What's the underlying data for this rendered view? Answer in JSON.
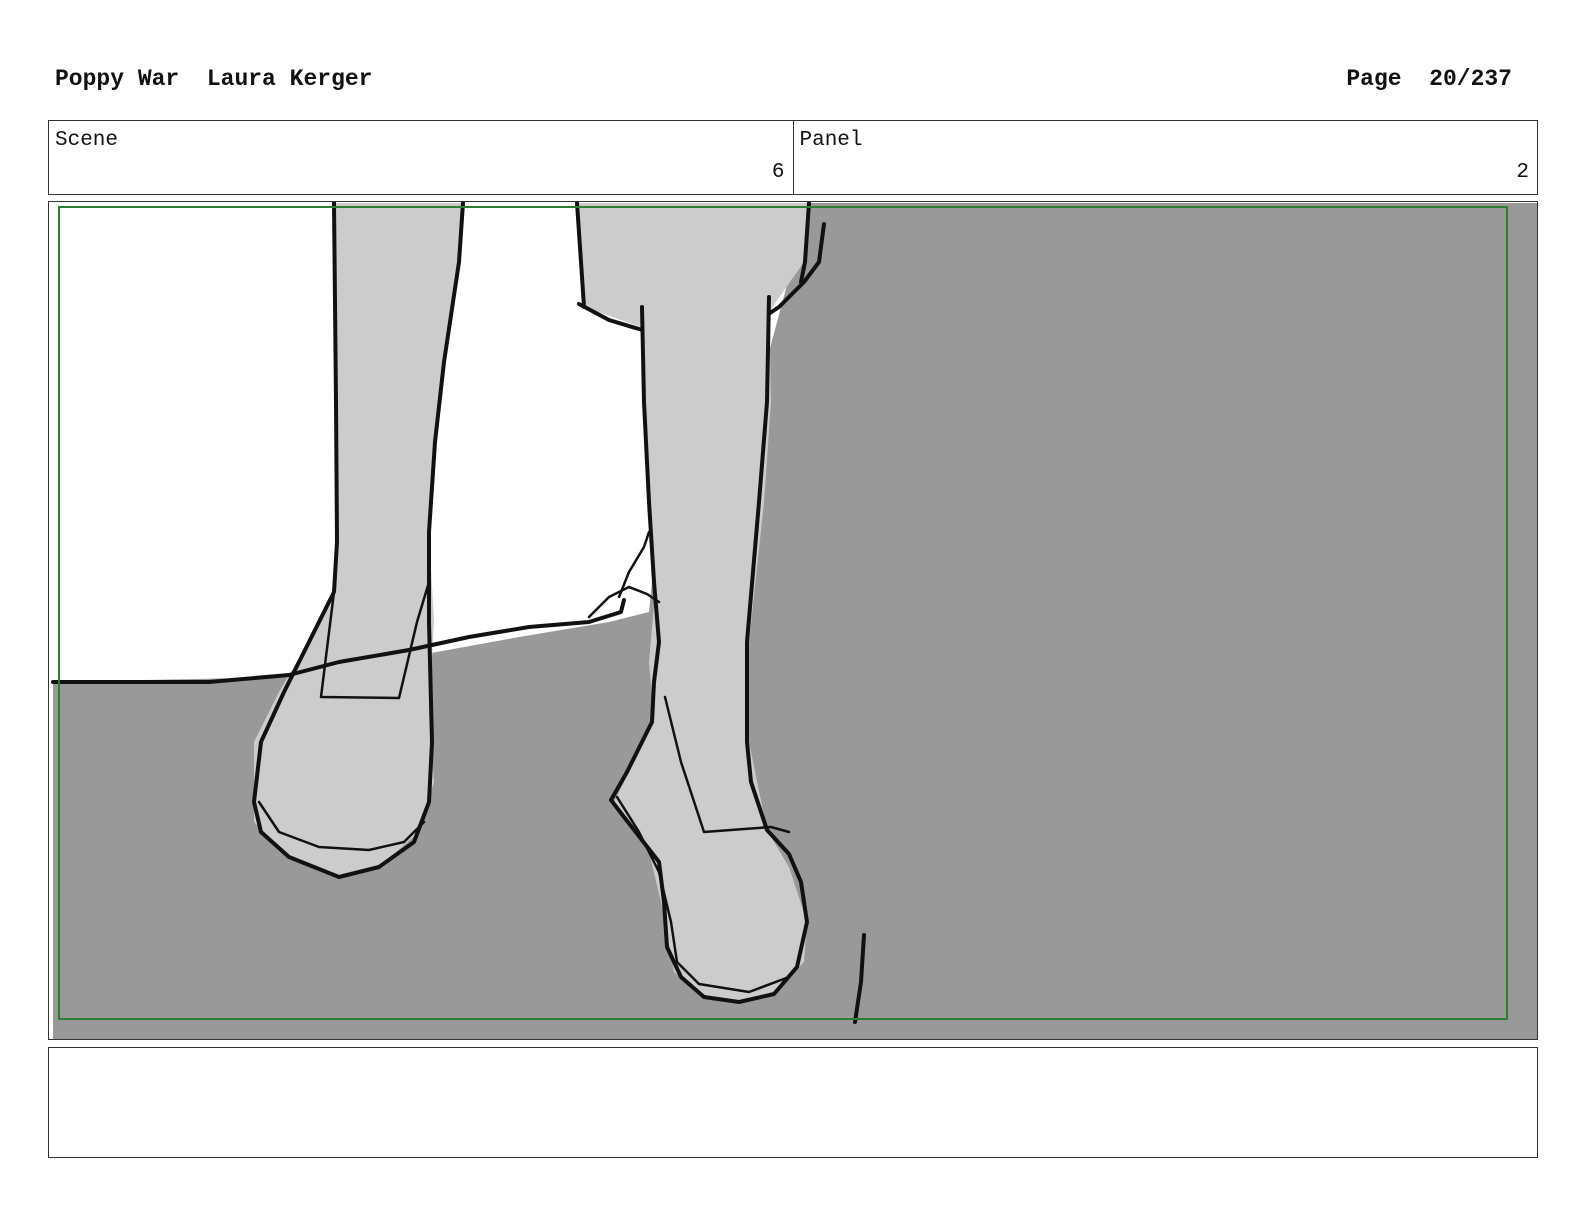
{
  "header": {
    "project": "Poppy War",
    "author": "Laura Kerger",
    "page_label": "Page",
    "page_number": "20/237"
  },
  "scene": {
    "label": "Scene",
    "value": "6"
  },
  "panel": {
    "label": "Panel",
    "value": "2"
  },
  "notes": {
    "text": ""
  },
  "colors": {
    "floor": "#999999",
    "leg_fill": "#cccccc",
    "background": "#ffffff",
    "safe_frame": "#2e7d32",
    "ink": "#111111"
  }
}
